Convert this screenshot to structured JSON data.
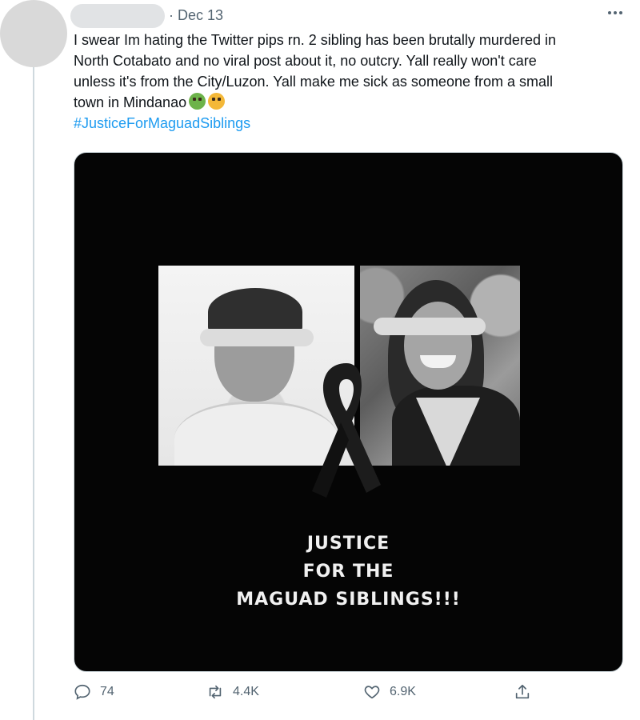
{
  "tweet": {
    "date": "Dec 13",
    "separator": "·",
    "text_lines": [
      "I swear Im hating the Twitter pips rn. 2 sibling has been brutally murdered in",
      "North Cotabato and no viral post about it, no outcry. Yall really won't care",
      "unless it's from the City/Luzon. Yall make me sick as someone from a small",
      "town in Mindanao"
    ],
    "emojis": [
      "nauseated-face-icon",
      "vomiting-face-icon"
    ],
    "hashtag": "#JusticeForMaguadSiblings"
  },
  "media": {
    "headline_lines": [
      "JUSTICE",
      "FOR THE",
      "MAGUAD SIBLINGS!!!"
    ],
    "icons": [
      "mourning-ribbon-icon"
    ]
  },
  "actions": {
    "replies": "74",
    "retweets": "4.4K",
    "likes": "6.9K"
  },
  "colors": {
    "hashtag": "#1d9bf0",
    "muted": "#536471",
    "media_background": "#050505"
  }
}
